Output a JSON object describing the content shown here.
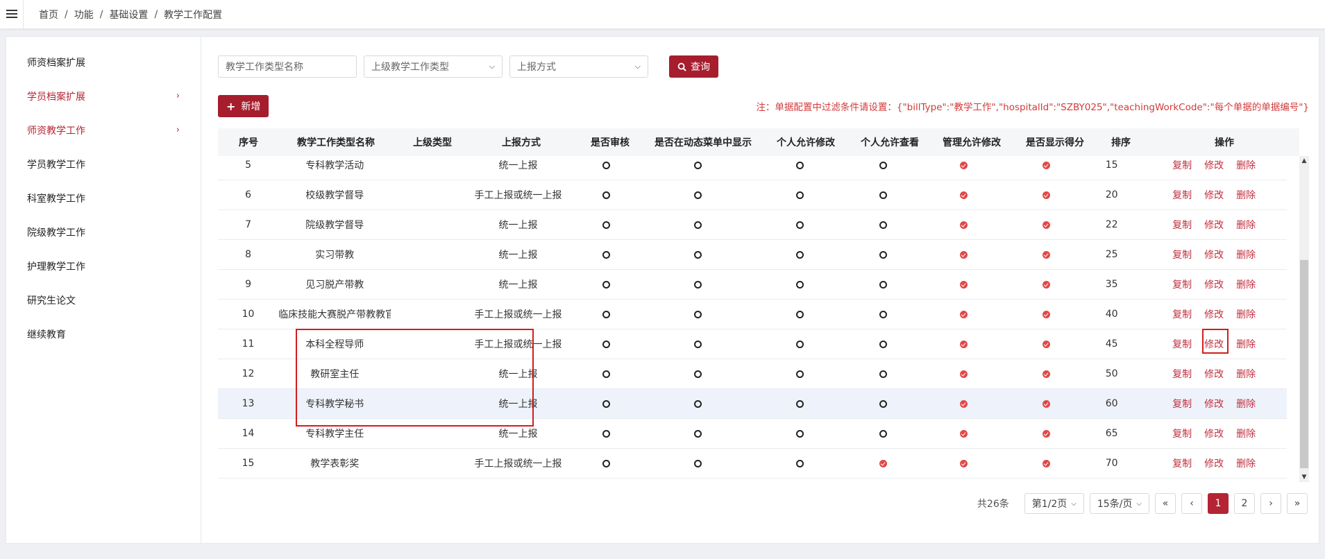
{
  "breadcrumb": [
    "首页",
    "功能",
    "基础设置",
    "教学工作配置"
  ],
  "sidebar": {
    "items": [
      {
        "label": "师资档案扩展",
        "active": false,
        "arrow": false
      },
      {
        "label": "学员档案扩展",
        "active": true,
        "arrow": true
      },
      {
        "label": "师资教学工作",
        "active": true,
        "arrow": true
      },
      {
        "label": "学员教学工作",
        "active": false,
        "arrow": false
      },
      {
        "label": "科室教学工作",
        "active": false,
        "arrow": false
      },
      {
        "label": "院级教学工作",
        "active": false,
        "arrow": false
      },
      {
        "label": "护理教学工作",
        "active": false,
        "arrow": false
      },
      {
        "label": "研究生论文",
        "active": false,
        "arrow": false
      },
      {
        "label": "继续教育",
        "active": false,
        "arrow": false
      }
    ]
  },
  "filters": {
    "name_placeholder": "教学工作类型名称",
    "parent_select": "上级教学工作类型",
    "method_select": "上报方式",
    "query_label": "查询"
  },
  "toolbar": {
    "add_label": "新增",
    "note": "注：单据配置中过滤条件请设置：{\"billType\":\"教学工作\",\"hospitalId\":\"SZBY025\",\"teachingWorkCode\":\"每个单据的单据编号\"}"
  },
  "table": {
    "headers": [
      "序号",
      "教学工作类型名称",
      "上级类型",
      "上报方式",
      "是否审核",
      "是否在动态菜单中显示",
      "个人允许修改",
      "个人允许查看",
      "管理允许修改",
      "是否显示得分",
      "排序",
      "操作"
    ],
    "ops": [
      "复制",
      "修改",
      "删除"
    ],
    "rows": [
      {
        "no": "5",
        "name": "专科教学活动",
        "parent": "",
        "method": "统一上报",
        "audit": false,
        "menu": false,
        "pm": false,
        "pv": false,
        "am": true,
        "score": true,
        "sort": "15"
      },
      {
        "no": "6",
        "name": "校级教学督导",
        "parent": "",
        "method": "手工上报或统一上报",
        "audit": false,
        "menu": false,
        "pm": false,
        "pv": false,
        "am": true,
        "score": true,
        "sort": "20"
      },
      {
        "no": "7",
        "name": "院级教学督导",
        "parent": "",
        "method": "统一上报",
        "audit": false,
        "menu": false,
        "pm": false,
        "pv": false,
        "am": true,
        "score": true,
        "sort": "22"
      },
      {
        "no": "8",
        "name": "实习带教",
        "parent": "",
        "method": "统一上报",
        "audit": false,
        "menu": false,
        "pm": false,
        "pv": false,
        "am": true,
        "score": true,
        "sort": "25"
      },
      {
        "no": "9",
        "name": "见习脱产带教",
        "parent": "",
        "method": "统一上报",
        "audit": false,
        "menu": false,
        "pm": false,
        "pv": false,
        "am": true,
        "score": true,
        "sort": "35"
      },
      {
        "no": "10",
        "name": "临床技能大赛脱产带教教官",
        "parent": "",
        "method": "手工上报或统一上报",
        "audit": false,
        "menu": false,
        "pm": false,
        "pv": false,
        "am": true,
        "score": true,
        "sort": "40"
      },
      {
        "no": "11",
        "name": "本科全程导师",
        "parent": "",
        "method": "手工上报或统一上报",
        "audit": false,
        "menu": false,
        "pm": false,
        "pv": false,
        "am": true,
        "score": true,
        "sort": "45"
      },
      {
        "no": "12",
        "name": "教研室主任",
        "parent": "",
        "method": "统一上报",
        "audit": false,
        "menu": false,
        "pm": false,
        "pv": false,
        "am": true,
        "score": true,
        "sort": "50"
      },
      {
        "no": "13",
        "name": "专科教学秘书",
        "parent": "",
        "method": "统一上报",
        "audit": false,
        "menu": false,
        "pm": false,
        "pv": false,
        "am": true,
        "score": true,
        "sort": "60"
      },
      {
        "no": "14",
        "name": "专科教学主任",
        "parent": "",
        "method": "统一上报",
        "audit": false,
        "menu": false,
        "pm": false,
        "pv": false,
        "am": true,
        "score": true,
        "sort": "65"
      },
      {
        "no": "15",
        "name": "教学表彰奖",
        "parent": "",
        "method": "手工上报或统一上报",
        "audit": false,
        "menu": false,
        "pm": false,
        "pv": true,
        "am": true,
        "score": true,
        "sort": "70"
      }
    ]
  },
  "pager": {
    "total": "共26条",
    "page_select": "第1/2页",
    "size_select": "15条/页",
    "first": "«",
    "prev": "‹",
    "pages": [
      "1",
      "2"
    ],
    "current": "1",
    "next": "›",
    "last": "»"
  },
  "colors": {
    "primary": "#a61d2d",
    "note": "#d23a3a",
    "check": "#e24848",
    "highlight_box": "#d31c1c"
  }
}
